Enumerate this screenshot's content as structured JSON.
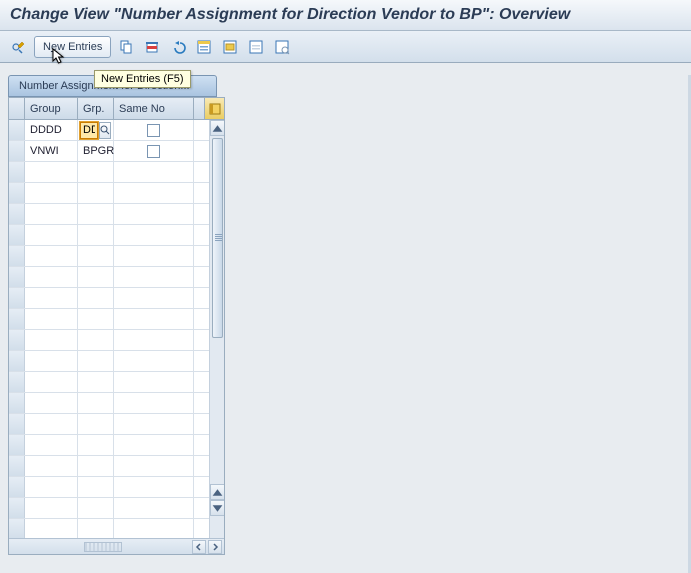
{
  "title": "Change View \"Number Assignment for Direction  Vendor to BP\": Overview",
  "toolbar": {
    "new_entries_label": "New Entries",
    "tooltip_text": "New Entries   (F5)"
  },
  "section": {
    "header": "Number Assignment for Direction..."
  },
  "columns": {
    "group": "Group",
    "grp": "Grp.",
    "same": "Same No"
  },
  "rows": [
    {
      "group": "DDDD",
      "grp": "DDDD",
      "same": false,
      "focused": true
    },
    {
      "group": "VNWI",
      "grp": "BPGR",
      "same": false,
      "focused": false
    }
  ]
}
